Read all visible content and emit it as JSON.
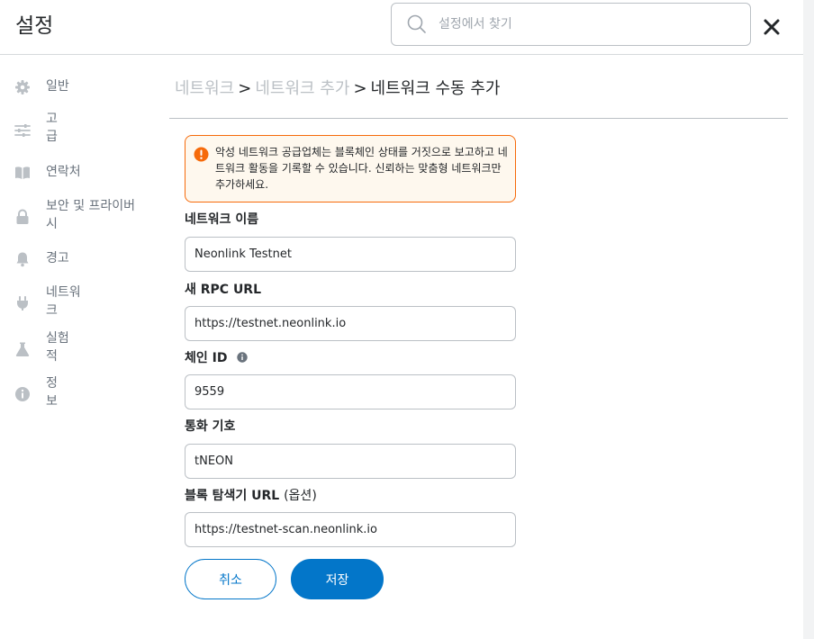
{
  "header": {
    "title": "설정",
    "search_placeholder": "설정에서 찾기"
  },
  "sidebar": {
    "items": [
      {
        "label": "일반",
        "icon": "gear-icon"
      },
      {
        "label": "고급",
        "icon": "sliders-icon"
      },
      {
        "label": "연락처",
        "icon": "book-icon"
      },
      {
        "label": "보안 및 프라이버시",
        "icon": "lock-icon"
      },
      {
        "label": "경고",
        "icon": "bell-icon"
      },
      {
        "label": "네트워크",
        "icon": "plug-icon"
      },
      {
        "label": "실험적",
        "icon": "flask-icon"
      },
      {
        "label": "정보",
        "icon": "info-icon"
      }
    ]
  },
  "breadcrumb": {
    "items": [
      "네트워크",
      "네트워크 추가",
      "네트워크 수동 추가"
    ],
    "separator": ">"
  },
  "warning": {
    "text": "악성 네트워크 공급업체는 블록체인 상태를 거짓으로 보고하고 네트워크 활동을 기록할 수 있습니다. 신뢰하는 맞춤형 네트워크만 추가하세요.",
    "border_color": "#f66a0a",
    "background_color": "#fef8ee"
  },
  "form": {
    "network_name": {
      "label": "네트워크 이름",
      "value": "Neonlink Testnet"
    },
    "rpc_url": {
      "label": "새 RPC URL",
      "value": "https://testnet.neonlink.io"
    },
    "chain_id": {
      "label": "체인 ID",
      "value": "9559"
    },
    "currency_symbol": {
      "label": "통화 기호",
      "value": "tNEON"
    },
    "explorer_url": {
      "label": "블록 탐색기 URL",
      "optional": "(옵션)",
      "value": "https://testnet-scan.neonlink.io"
    }
  },
  "buttons": {
    "cancel": "취소",
    "save": "저장"
  },
  "colors": {
    "accent": "#0376c9",
    "text": "#24272a",
    "muted": "#6a737d"
  }
}
